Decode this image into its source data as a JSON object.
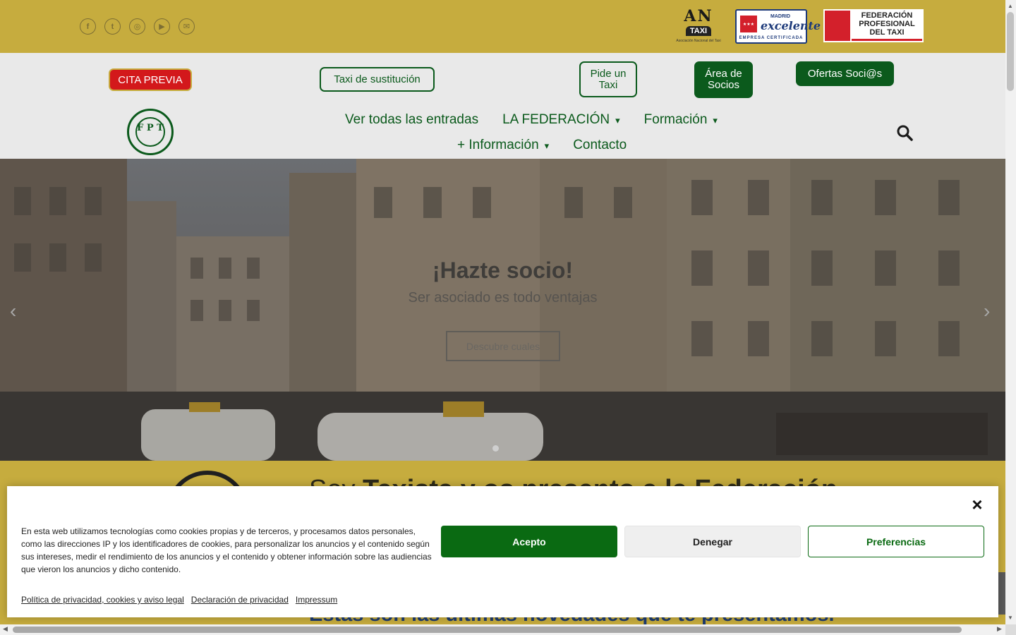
{
  "social": {
    "icons": [
      "facebook-icon",
      "twitter-icon",
      "instagram-icon",
      "youtube-icon",
      "email-icon"
    ]
  },
  "logos": {
    "antaxi": {
      "an": "AN",
      "taxi": "TAXI",
      "sub": "Asociación Nacional del Taxi"
    },
    "madrid": {
      "madrid": "MADRID",
      "excelente": "excelente",
      "cert": "EMPRESA CERTIFICADA"
    },
    "fpt": {
      "line1": "FEDERACIÓN",
      "line2": "PROFESIONAL",
      "line3": "DEL TAXI"
    },
    "main": {
      "letters": "F P T"
    }
  },
  "header": {
    "cita_previa": "CITA PREVIA",
    "taxi_sustitucion": "Taxi de sustitución",
    "pide_taxi": "Pide un Taxi",
    "area_socios": "Área de Socios",
    "ofertas": "Ofertas Soci@s"
  },
  "nav": {
    "row1": [
      {
        "label": "Ver todas las entradas",
        "dropdown": false
      },
      {
        "label": "LA FEDERACIÓN",
        "dropdown": true
      },
      {
        "label": "Formación",
        "dropdown": true
      }
    ],
    "row2": [
      {
        "label": "+ Información",
        "dropdown": true
      },
      {
        "label": "Contacto",
        "dropdown": false
      }
    ],
    "chevron": "⌄"
  },
  "hero": {
    "title": "¡Hazte socio!",
    "subtitle": "Ser asociado es todo ventajas",
    "button": "Descubre cuales",
    "prev": "‹",
    "next": "›"
  },
  "content": {
    "title_part1": "Soy ",
    "title_part2": "Taxista y os presento a la Federación",
    "bottom": "Estas son las últimas novedades que te presentamos."
  },
  "cookie": {
    "close": "×",
    "text": "En esta web utilizamos tecnologías como cookies propias y de terceros, y procesamos datos personales, como las direcciones IP y los identificadores de cookies, para personalizar los anuncios y el contenido según sus intereses, medir el rendimiento de los anuncios y el contenido y obtener información sobre las audiencias que vieron los anuncios y dicho contenido.",
    "accept": "Acepto",
    "deny": "Denegar",
    "preferences": "Preferencias",
    "links": [
      "Política de privacidad, cookies y aviso legal",
      "Declaración de privacidad",
      "Impressum"
    ]
  },
  "colors": {
    "gold": "#c6ac3e",
    "green": "#0b5a1c",
    "red": "#d3181b",
    "accept_green": "#0a6a12"
  }
}
